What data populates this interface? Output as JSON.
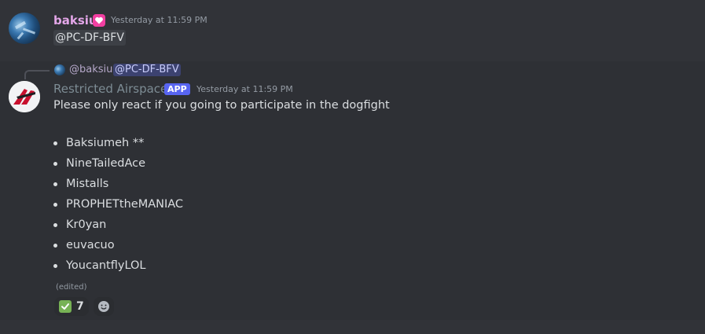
{
  "message1": {
    "username": "baksiu",
    "badge_icon": "heart-badge-icon",
    "timestamp": "Yesterday at 11:59 PM",
    "mention": "@PC-DF-BFV"
  },
  "message2": {
    "reply": {
      "username": "@baksiu",
      "mention": "@PC-DF-BFV"
    },
    "username": "Restricted Airspace",
    "app_tag": "APP",
    "timestamp": "Yesterday at 11:59 PM",
    "content": "Please only react if you going to participate in the dogfight",
    "participants": [
      "Baksiumeh **",
      "NineTailedAce",
      "Mistalls",
      "PROPHETtheMANIAC",
      "Kr0yan",
      "euvacuo",
      "YoucantflyLOL"
    ],
    "edited_label": "(edited)",
    "reaction": {
      "emoji": "white-check-mark-icon",
      "count": "7"
    }
  },
  "colors": {
    "background": "#313338",
    "highlight_row": "#2e3035",
    "username1": "#e3a6e8",
    "app_tag": "#5865f2",
    "check_green": "#77b255"
  }
}
